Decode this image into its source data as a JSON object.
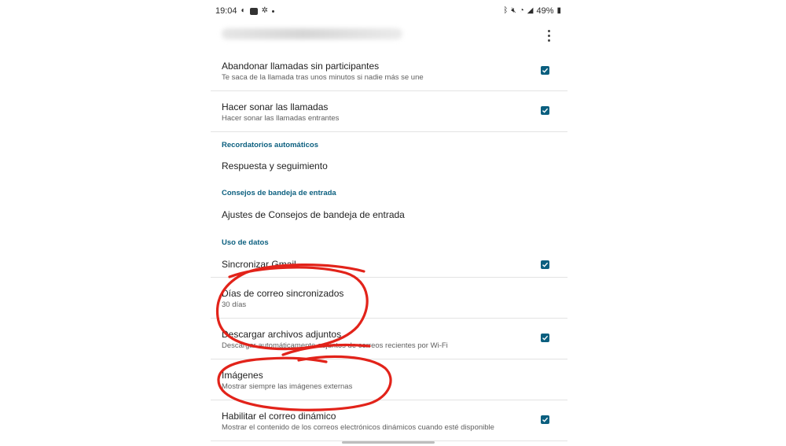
{
  "status_bar": {
    "time": "19:04",
    "battery": "49%",
    "icons_left": [
      "whatsapp-icon",
      "app-icon",
      "settings-icon",
      "notification-dot"
    ],
    "icons_right": [
      "bluetooth-icon",
      "mute-icon",
      "wifi-icon",
      "signal-icon",
      "battery-icon"
    ]
  },
  "app_bar": {
    "account_blurred": true,
    "more_icon": "more-vert-icon"
  },
  "settings": [
    {
      "type": "item",
      "title": "Abandonar llamadas sin participantes",
      "subtitle": "Te saca de la llamada tras unos minutos si nadie más se une",
      "checked": true
    },
    {
      "type": "item",
      "title": "Hacer sonar las llamadas",
      "subtitle": "Hacer sonar las llamadas entrantes",
      "checked": true
    },
    {
      "type": "header",
      "title": "Recordatorios automáticos"
    },
    {
      "type": "item",
      "title": "Respuesta y seguimiento"
    },
    {
      "type": "header",
      "title": "Consejos de bandeja de entrada"
    },
    {
      "type": "item",
      "title": "Ajustes de Consejos de bandeja de entrada"
    },
    {
      "type": "header",
      "title": "Uso de datos"
    },
    {
      "type": "item",
      "title": "Sincronizar Gmail",
      "checked": true
    },
    {
      "type": "item",
      "title": "Días de correo sincronizados",
      "subtitle": "30 días"
    },
    {
      "type": "item",
      "title": "Descargar archivos adjuntos",
      "subtitle": "Descargar automáticamente adjuntos de correos recientes por Wi-Fi",
      "checked": true
    },
    {
      "type": "item",
      "title": "Imágenes",
      "subtitle": "Mostrar siempre las imágenes externas"
    },
    {
      "type": "item",
      "title": "Habilitar el correo dinámico",
      "subtitle": "Mostrar el contenido de los correos electrónicos dinámicos cuando esté disponible",
      "checked": true
    }
  ],
  "colors": {
    "accent": "#0b5f7f",
    "annotation": "#e2231a",
    "divider": "#e3e3e3"
  }
}
